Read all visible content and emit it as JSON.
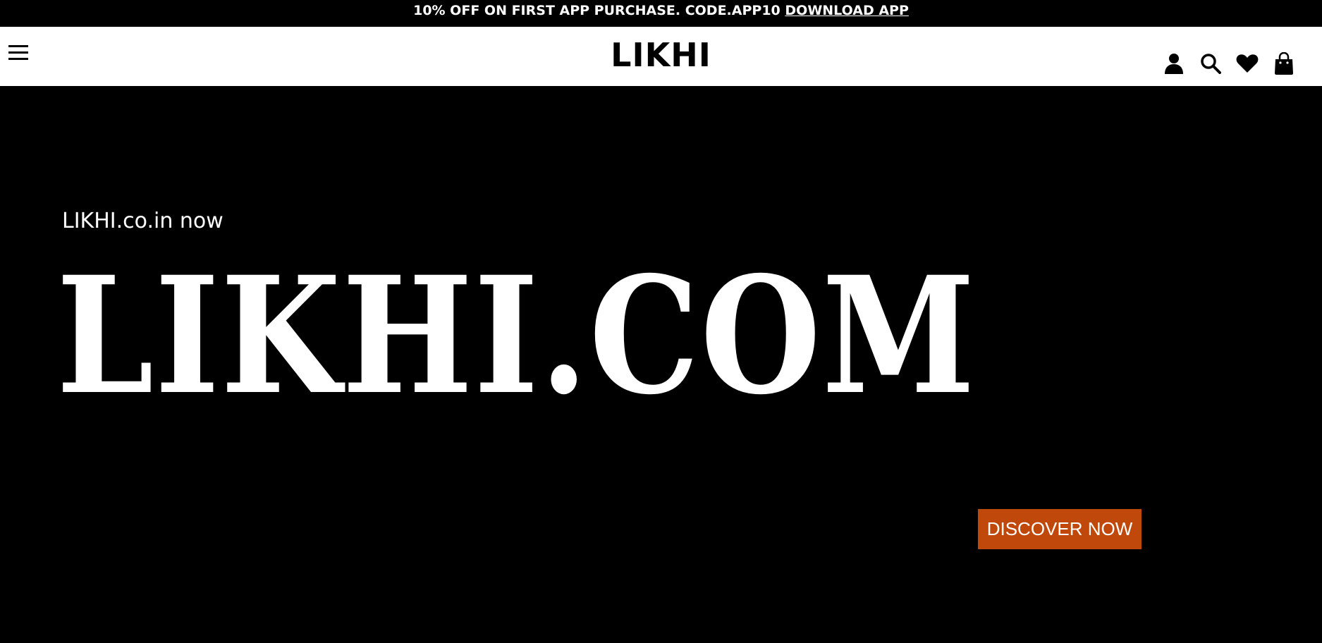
{
  "announcement": {
    "text": "10% OFF ON FIRST APP PURCHASE. CODE.APP10",
    "link_label": "DOWNLOAD APP"
  },
  "header": {
    "logo": "LIKHI",
    "icons": [
      "menu-icon",
      "user-icon",
      "search-icon",
      "heart-icon",
      "shopping-bag-icon"
    ]
  },
  "hero": {
    "eyebrow": "LIKHI.co.in now",
    "title": "LIKHI.COM",
    "cta_label": "DISCOVER NOW"
  },
  "colors": {
    "background": "#000000",
    "header_bg": "#ffffff",
    "accent": "#c0480a",
    "text_on_dark": "#ffffff"
  }
}
